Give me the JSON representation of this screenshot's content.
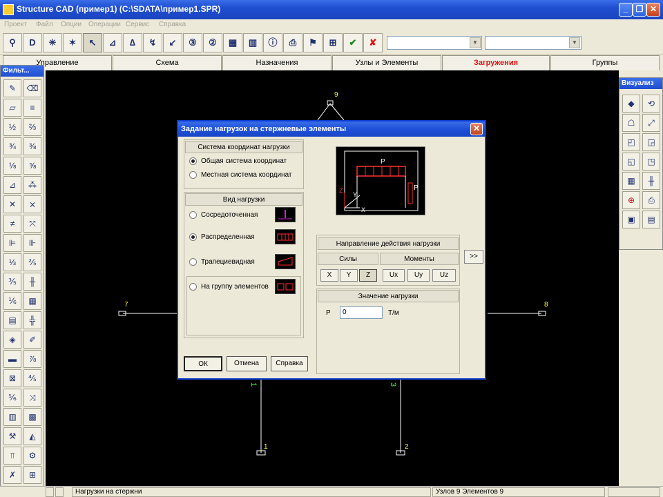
{
  "window": {
    "title": "Structure CAD (пример1) (C:\\SDATA\\пример1.SPR)",
    "minimize": "_",
    "maximize": "❐",
    "close": "✕"
  },
  "menu": [
    "Проект",
    "Файл",
    "Опции",
    "Операции",
    "Сервис",
    "Справка"
  ],
  "toolbar": {
    "buttons": [
      "measure-icon",
      "d-icon",
      "nodes-icon",
      "elements-icon",
      "pointer-icon",
      "support-icon",
      "hinge-icon",
      "node-load-icon",
      "force-icon",
      "load-case-icon",
      "rigidity-icon",
      "table-icon",
      "chart-icon",
      "info-icon",
      "print-icon",
      "zoom-icon",
      "accept-icon",
      "delete-icon"
    ],
    "d_label": "D",
    "combo1_value": "",
    "combo2_value": ""
  },
  "tabs": [
    "Управление",
    "Схема",
    "Назначения",
    "Узлы и Элементы",
    "Загружения",
    "Группы"
  ],
  "active_tab": "Загружения",
  "left_palette": {
    "title": "Фильт..."
  },
  "right_palette": {
    "title": "Визуализ"
  },
  "canvas": {
    "node_labels": [
      "9",
      "7",
      "8",
      "1",
      "2"
    ],
    "element_labels": [
      "1",
      "3"
    ],
    "colors": {
      "background": "#000000",
      "line": "#ffffff",
      "node_label": "#ffff33",
      "element_label": "#33ff33"
    }
  },
  "dialog": {
    "title": "Задание нагрузок на стержневые элементы",
    "coord_system": {
      "heading": "Система координат нагрузки",
      "options": [
        "Общая система координат",
        "Местная  система координат"
      ],
      "selected": 0
    },
    "load_type": {
      "heading": "Вид нагрузки",
      "options": [
        "Сосредоточенная",
        "Распределенная",
        "Трапециевидная",
        "На группу элементов"
      ],
      "selected": 1
    },
    "preview": {
      "p_label": "P",
      "y_axis": "Y",
      "x_axis": "X",
      "z_axis": "Z",
      "p2_label": "P"
    },
    "direction": {
      "heading": "Направление действия нагрузки",
      "forces_heading": "Силы",
      "moments_heading": "Моменты",
      "forces": [
        "X",
        "Y",
        "Z"
      ],
      "moments": [
        "Ux",
        "Uy",
        "Uz"
      ],
      "selected_force": "Z"
    },
    "value": {
      "heading": "Значение нагрузки",
      "p_label": "P",
      "p_value": "0",
      "unit": "Т/м"
    },
    "expand_button": ">>",
    "buttons": {
      "ok": "ОК",
      "cancel": "Отмена",
      "help": "Справка"
    }
  },
  "statusbar": {
    "message": "Нагрузки на стержни",
    "info": "Узлов 9 Элементов 9"
  }
}
